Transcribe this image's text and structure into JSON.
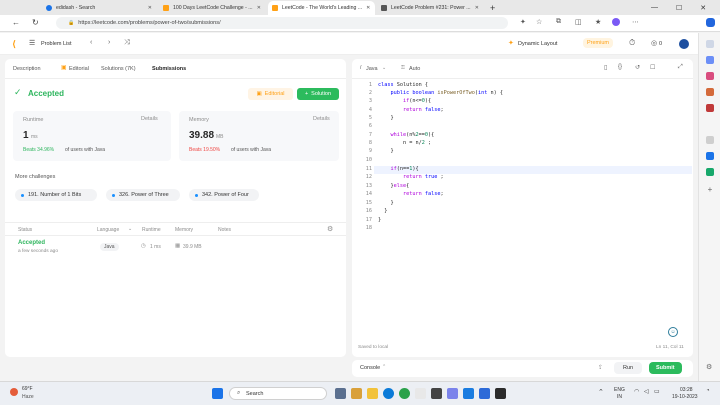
{
  "browser": {
    "tabs": [
      {
        "label": "edidash - Search",
        "color": "#1a73e8"
      },
      {
        "label": "100 Days LeetCode Challenge - ...",
        "color": "#ffa116"
      },
      {
        "label": "LeetCode - The World's Leading ...",
        "color": "#ffa116"
      },
      {
        "label": "LeetCode Problem #231: Power ...",
        "color": "#555555"
      }
    ],
    "url": "https://leetcode.com/problems/power-of-two/submissions/"
  },
  "lc_header": {
    "problem_list": "Problem List",
    "dynamic_layout": "Dynamic Layout",
    "premium": "Premium",
    "coins": "0"
  },
  "left": {
    "tabs": {
      "description": "Description",
      "editorial": "Editorial",
      "solutions": "Solutions (7K)",
      "submissions": "Submissions"
    },
    "status": "Accepted",
    "editorial_btn": "Editorial",
    "solution_btn": "Solution",
    "runtime": {
      "label": "Runtime",
      "details": "Details",
      "value": "1",
      "unit": "ms",
      "beats": "Beats 34.96%",
      "beats_suffix": "of users with Java"
    },
    "memory": {
      "label": "Memory",
      "details": "Details",
      "value": "39.88",
      "unit": "MB",
      "beats": "Beats 19.50%",
      "beats_suffix": "of users with Java"
    },
    "more_title": "More challenges",
    "challenges": [
      "191. Number of 1 Bits",
      "326. Power of Three",
      "342. Power of Four"
    ],
    "table": {
      "headers": {
        "status": "Status",
        "language": "Language",
        "runtime": "Runtime",
        "memory": "Memory",
        "notes": "Notes"
      },
      "row": {
        "status": "Accepted",
        "time": "a few seconds ago",
        "language": "Java",
        "runtime": "1 ms",
        "memory": "39.9 MB"
      }
    }
  },
  "editor": {
    "language": "Java",
    "mode": "Auto",
    "code": [
      "class Solution {",
      "    public boolean isPowerOfTwo(int n) {",
      "        if(n<=0){",
      "        return false;",
      "    }",
      "",
      "    while(n%2==0){",
      "        n = n/2 ;",
      "    }",
      "",
      "    if(n==1){",
      "        return true ;",
      "    }else{",
      "        return false;",
      "    }",
      "  }",
      "}",
      ""
    ],
    "saved": "Saved to local",
    "cursor": "Ln 11, Col 11"
  },
  "console": {
    "label": "Console",
    "run": "Run",
    "submit": "Submit"
  },
  "taskbar": {
    "weather_temp": "69°F",
    "weather_desc": "Haze",
    "search": "Search",
    "lang": "ENG",
    "region": "IN",
    "time": "03:28",
    "date": "19-10-2023"
  },
  "colors": {
    "accent_green": "#2cbb5d",
    "accepted": "#2db55d",
    "orange": "#ffa116",
    "beats_red": "#ef4743"
  }
}
